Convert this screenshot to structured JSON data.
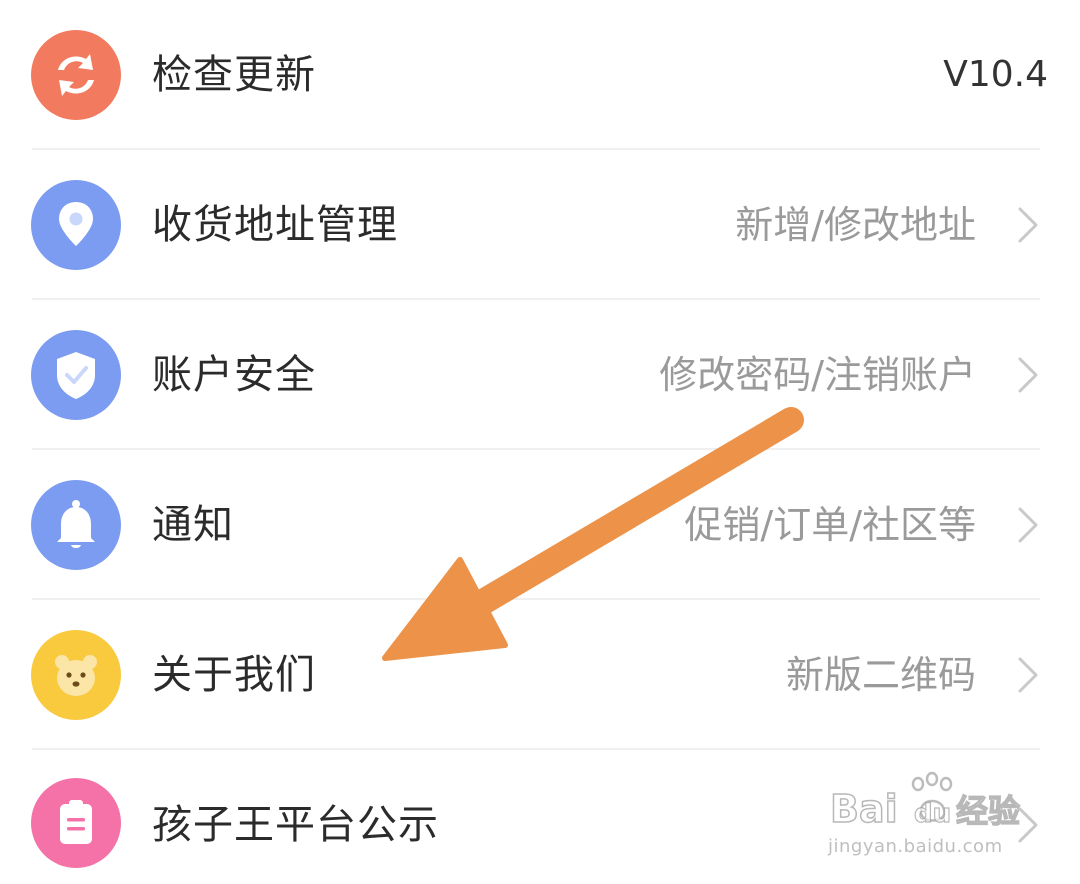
{
  "menu": {
    "items": [
      {
        "label": "检查更新",
        "sub": "",
        "version": "V10.4",
        "icon": "refresh-icon",
        "color": "#F27A5E"
      },
      {
        "label": "收货地址管理",
        "sub": "新增/修改地址",
        "icon": "location-pin-icon",
        "color": "#7B9CF0"
      },
      {
        "label": "账户安全",
        "sub": "修改密码/注销账户",
        "icon": "shield-icon",
        "color": "#7B9CF0"
      },
      {
        "label": "通知",
        "sub": "促销/订单/社区等",
        "icon": "bell-icon",
        "color": "#7B9CF0"
      },
      {
        "label": "关于我们",
        "sub": "新版二维码",
        "icon": "bear-face-icon",
        "color": "#F9C93E"
      },
      {
        "label": "孩子王平台公示",
        "sub": "",
        "icon": "clipboard-icon",
        "color": "#F472A8"
      }
    ]
  },
  "annotation": {
    "arrow_color": "#EC9249"
  },
  "watermark": {
    "brand": "Bai",
    "brand2": "du",
    "brand3": "经验",
    "url": "jingyan.baidu.com"
  }
}
